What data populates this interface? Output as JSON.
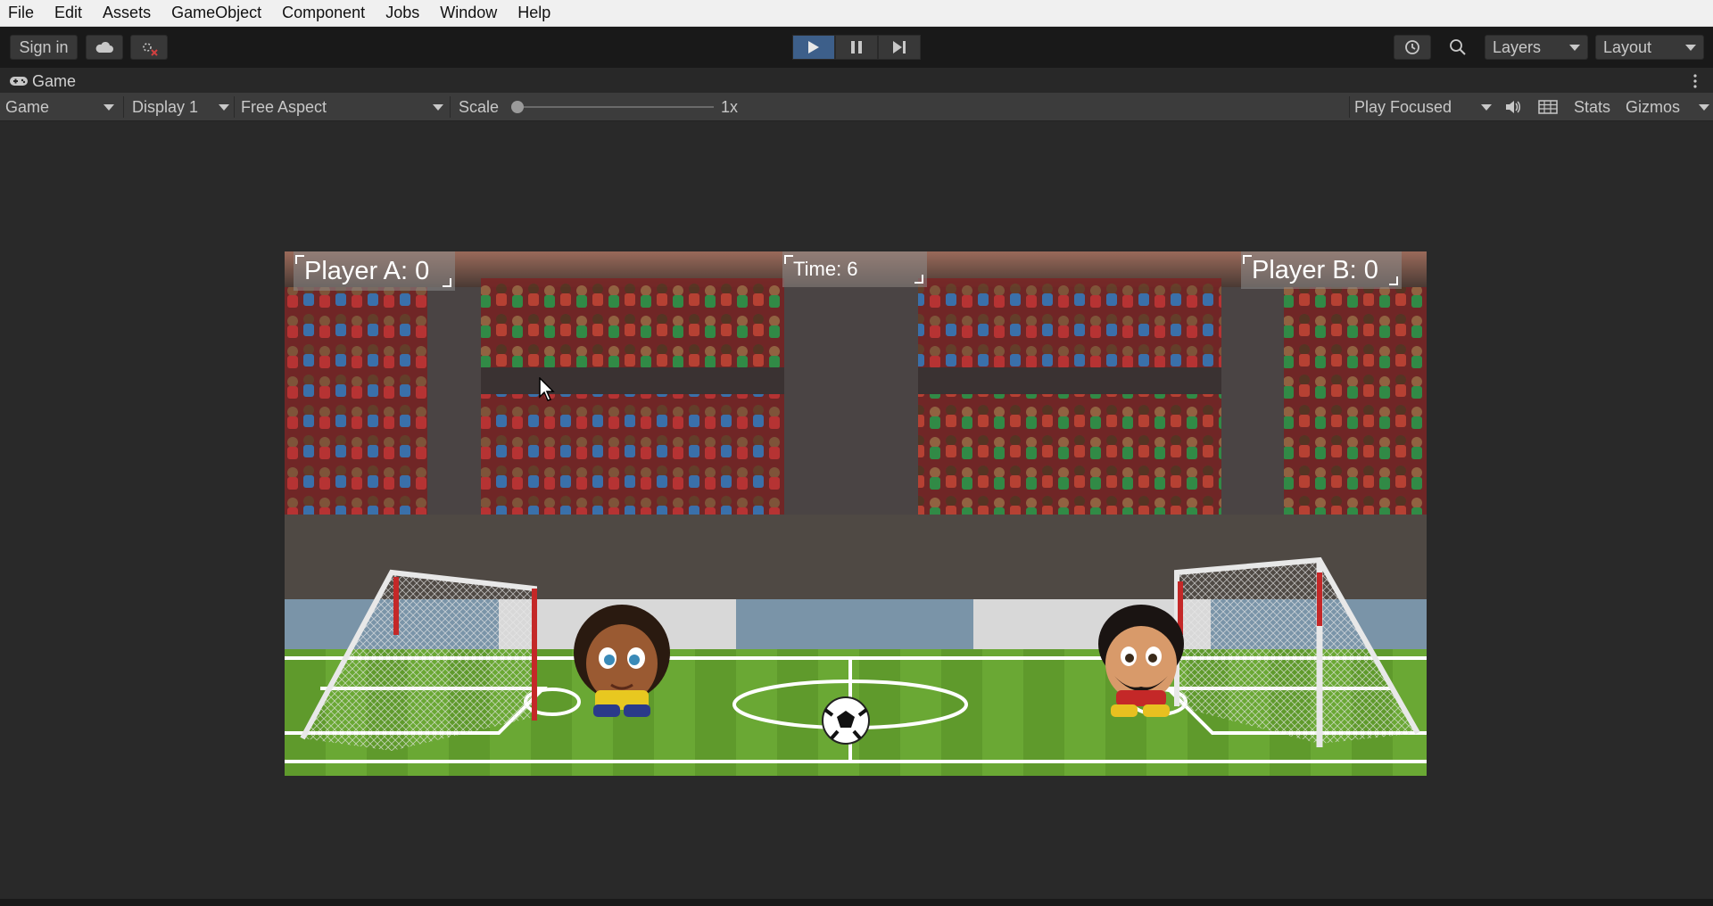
{
  "menu": [
    "File",
    "Edit",
    "Assets",
    "GameObject",
    "Component",
    "Jobs",
    "Window",
    "Help"
  ],
  "toolbar": {
    "sign_in": "Sign in",
    "layers": "Layers",
    "layout": "Layout"
  },
  "tab": {
    "label": "Game"
  },
  "gamebar": {
    "mode": "Game",
    "display": "Display 1",
    "aspect": "Free Aspect",
    "scale_label": "Scale",
    "scale_value": "1x",
    "scale_slider": 0.0,
    "play_mode": "Play Focused",
    "stats": "Stats",
    "gizmos": "Gizmos"
  },
  "hud": {
    "player_a": "Player A: 0",
    "time": "Time: 6",
    "player_b": "Player B: 0"
  },
  "colors": {
    "menubar": "#f0f0f0",
    "toolbar": "#191919",
    "play_active": "#3d5f8a",
    "editor_bg": "#282828",
    "pitch_green": "#5f9a2c",
    "seat_red": "#b3222b"
  }
}
